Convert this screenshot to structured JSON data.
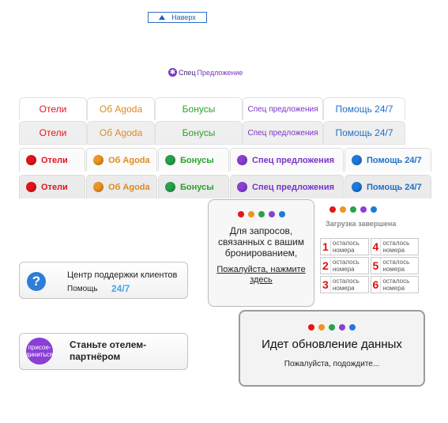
{
  "up_button": {
    "label": "Наверх"
  },
  "special_offer_logo": {
    "word1": "Спец",
    "word2": "Предложение"
  },
  "tabs": {
    "hotels": "Отели",
    "about": "Об Agoda",
    "bonuses": "Бонусы",
    "special": "Спец предложения",
    "help": "Помощь 24/7"
  },
  "request_box": {
    "text": "Для запросов, связанных с вашим бронированием,",
    "link": "Пожалуйста, нажмите здесь"
  },
  "loading": {
    "text": "Загрузка завершена"
  },
  "rooms": [
    {
      "num": "1",
      "label": "осталось номера"
    },
    {
      "num": "4",
      "label": "осталось номера"
    },
    {
      "num": "2",
      "label": "осталось номера"
    },
    {
      "num": "5",
      "label": "осталось номера"
    },
    {
      "num": "3",
      "label": "осталось номера"
    },
    {
      "num": "6",
      "label": "осталось номера"
    }
  ],
  "support": {
    "title": "Центр поддержки клиентов",
    "help": "Помощь",
    "hours": "24/7"
  },
  "join": {
    "icon_text": "присое-диниться",
    "text": "Станьте отелем-партнёром"
  },
  "update_box": {
    "title": "Идет обновление данных",
    "subtitle": "Пожалуйста, подождите..."
  },
  "colors": {
    "red": "#e3151b",
    "orange": "#ee9520",
    "green": "#27a24a",
    "purple": "#8a3fd6",
    "blue": "#1e7ad9"
  }
}
